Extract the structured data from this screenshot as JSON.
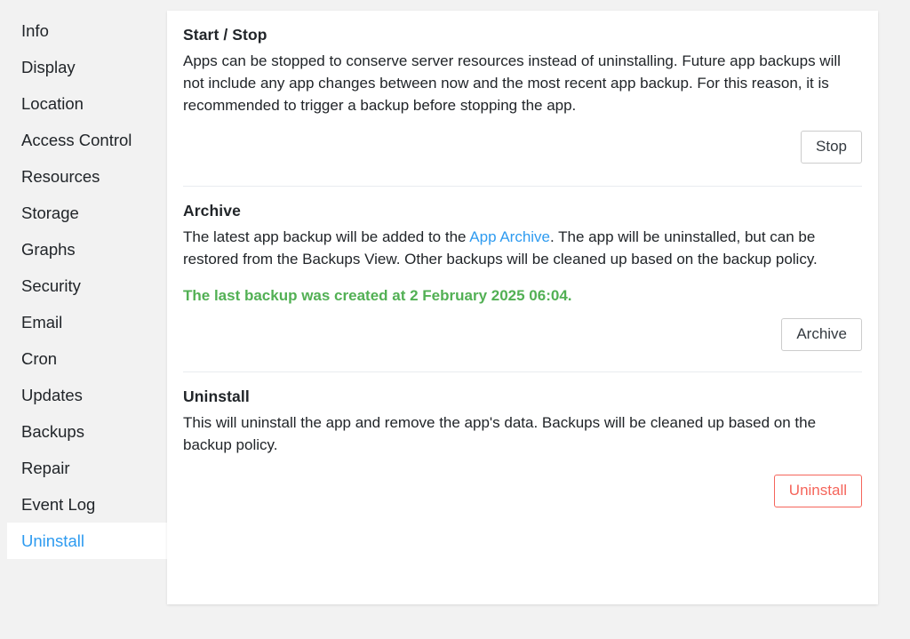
{
  "sidebar": {
    "items": [
      {
        "label": "Info",
        "active": false
      },
      {
        "label": "Display",
        "active": false
      },
      {
        "label": "Location",
        "active": false
      },
      {
        "label": "Access Control",
        "active": false
      },
      {
        "label": "Resources",
        "active": false
      },
      {
        "label": "Storage",
        "active": false
      },
      {
        "label": "Graphs",
        "active": false
      },
      {
        "label": "Security",
        "active": false
      },
      {
        "label": "Email",
        "active": false
      },
      {
        "label": "Cron",
        "active": false
      },
      {
        "label": "Updates",
        "active": false
      },
      {
        "label": "Backups",
        "active": false
      },
      {
        "label": "Repair",
        "active": false
      },
      {
        "label": "Event Log",
        "active": false
      },
      {
        "label": "Uninstall",
        "active": true
      }
    ]
  },
  "sections": {
    "start_stop": {
      "title": "Start / Stop",
      "body": "Apps can be stopped to conserve server resources instead of uninstalling. Future app backups will not include any app changes between now and the most recent app backup. For this reason, it is recommended to trigger a backup before stopping the app.",
      "button_label": "Stop"
    },
    "archive": {
      "title": "Archive",
      "body_part1": "The latest app backup will be added to the ",
      "link_label": "App Archive",
      "body_part2": ". The app will be uninstalled, but can be restored from the Backups View. Other backups will be cleaned up based on the backup policy.",
      "status": "The last backup was created at 2 February 2025 06:04.",
      "button_label": "Archive"
    },
    "uninstall": {
      "title": "Uninstall",
      "body": "This will uninstall the app and remove the app's data. Backups will be cleaned up based on the backup policy.",
      "button_label": "Uninstall"
    }
  },
  "colors": {
    "accent": "#2e9bf0",
    "success": "#52b054",
    "danger": "#f5655b",
    "page_background": "#f2f2f2",
    "card_background": "#ffffff"
  }
}
